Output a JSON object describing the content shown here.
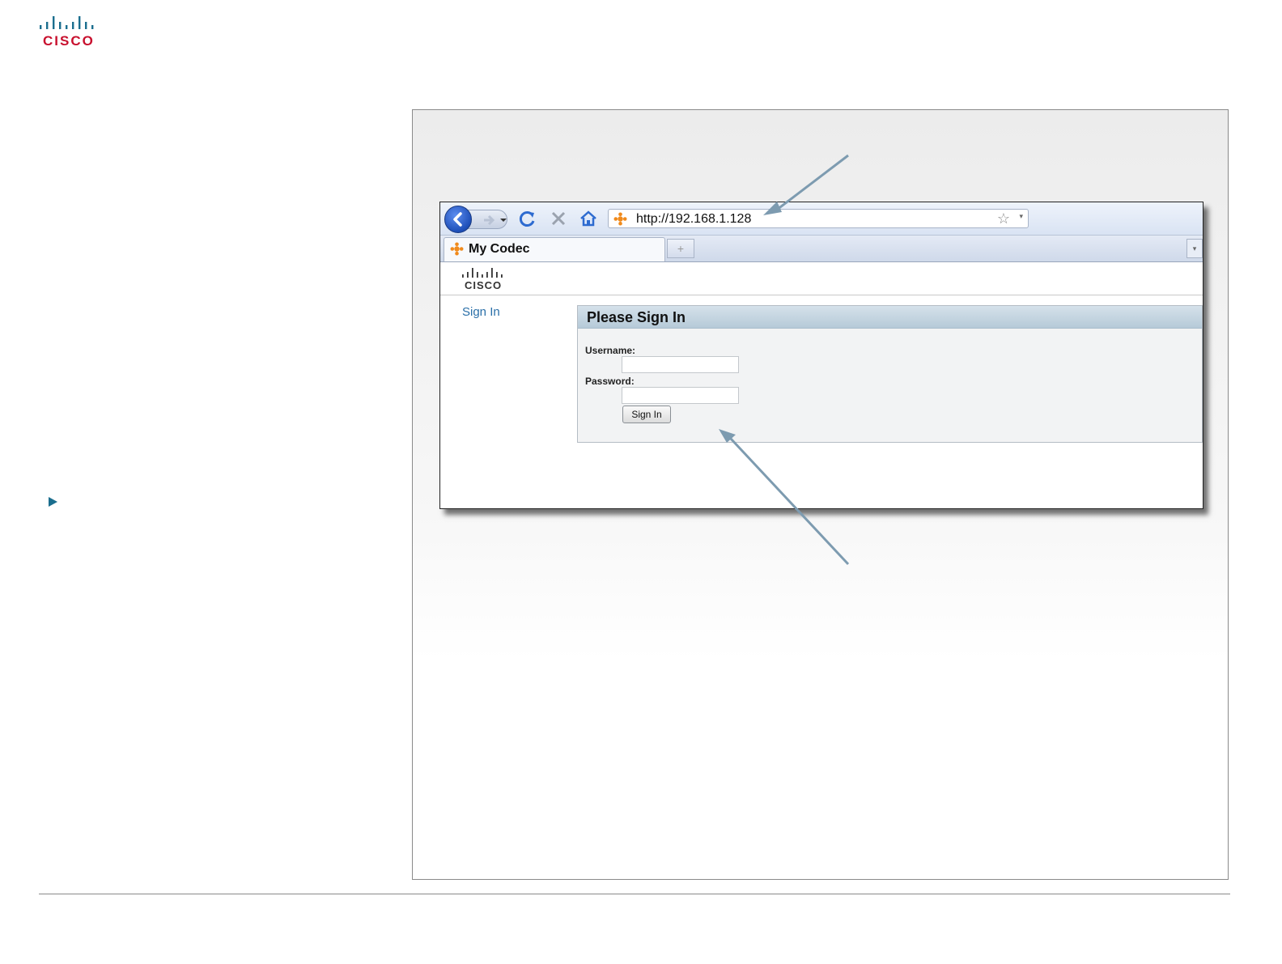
{
  "brand": {
    "logo_text": "CISCO"
  },
  "browser": {
    "url": "http://192.168.1.128",
    "tab_title": "My Codec",
    "new_tab_symbol": "+",
    "tab_list_symbol": "▾",
    "url_dropdown_symbol": "▾",
    "bookmark_symbol": "☆"
  },
  "page": {
    "logo_text": "CISCO",
    "nav": {
      "sign_in_link": "Sign In"
    },
    "signin_panel": {
      "title": "Please Sign In",
      "username_label": "Username:",
      "username_value": "",
      "password_label": "Password:",
      "password_value": "",
      "submit_label": "Sign In"
    }
  },
  "colors": {
    "cisco_bars": "#1b6e8e",
    "cisco_text": "#c8102e",
    "arrow": "#7d9bb0",
    "link": "#2a6fa8"
  }
}
